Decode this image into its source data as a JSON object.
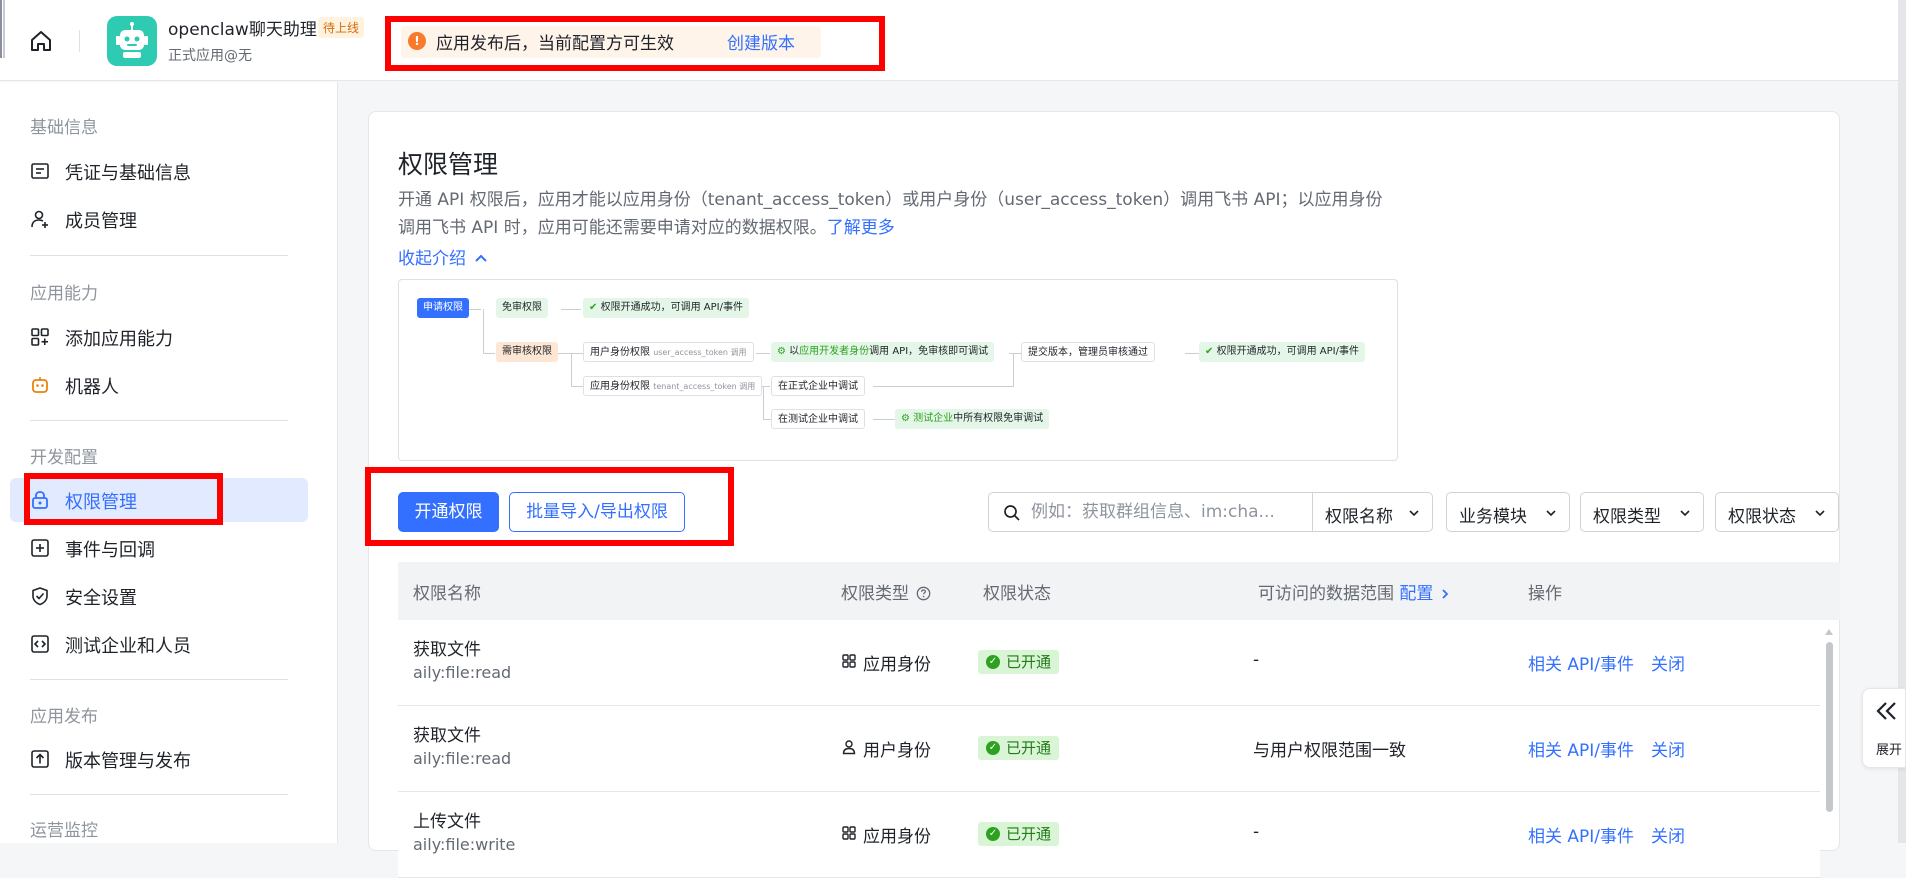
{
  "topbar": {
    "app_name": "openclaw聊天助理",
    "app_badge": "待上线",
    "app_subtitle": "正式应用@无",
    "notice_text": "应用发布后，当前配置方可生效",
    "notice_link": "创建版本"
  },
  "sidebar": {
    "sections": [
      {
        "title": "基础信息",
        "items": [
          "凭证与基础信息",
          "成员管理"
        ]
      },
      {
        "title": "应用能力",
        "items": [
          "添加应用能力",
          "机器人"
        ]
      },
      {
        "title": "开发配置",
        "items": [
          "权限管理",
          "事件与回调",
          "安全设置",
          "测试企业和人员"
        ]
      },
      {
        "title": "应用发布",
        "items": [
          "版本管理与发布"
        ]
      },
      {
        "title": "运营监控",
        "items": []
      }
    ],
    "active_item": "权限管理"
  },
  "main": {
    "title": "权限管理",
    "description": "开通 API 权限后，应用才能以应用身份（tenant_access_token）或用户身份（user_access_token）调用飞书 API；以应用身份调用飞书 API 时，应用可能还需要申请对应的数据权限。",
    "learn_more": "了解更多",
    "collapse_label": "收起介绍"
  },
  "flow": {
    "apply": "申请权限",
    "no_review": "免审权限",
    "no_review_result": "权限开通成功，可调用 API/事件",
    "needs_review": "需审核权限",
    "user_perm": "用户身份权限",
    "user_token": "user_access_token 调用",
    "dev_call_prefix": "以",
    "dev_call_highlight": "应用开发者身份",
    "dev_call_suffix": "调用 API，免审核即可调试",
    "submit": "提交版本，管理员审核通过",
    "final_result": "权限开通成功，可调用 API/事件",
    "app_perm": "应用身份权限",
    "tenant_token": "tenant_access_token 调用",
    "prod_debug": "在正式企业中调试",
    "test_debug": "在测试企业中调试",
    "test_free_highlight": "测试企业",
    "test_free_suffix": "中所有权限免审调试"
  },
  "actions": {
    "enable_button": "开通权限",
    "import_export_button": "批量导入/导出权限",
    "search_placeholder": "例如：获取群组信息、im:cha...",
    "filter_name": "权限名称",
    "filter_module": "业务模块",
    "filter_type": "权限类型",
    "filter_status": "权限状态"
  },
  "table": {
    "headers": {
      "name": "权限名称",
      "type": "权限类型",
      "status": "权限状态",
      "scope": "可访问的数据范围",
      "scope_config": "配置",
      "ops": "操作"
    },
    "rows": [
      {
        "name": "获取文件",
        "code": "aily:file:read",
        "type": "应用身份",
        "type_icon": "grid-icon",
        "status": "已开通",
        "scope": "-",
        "api": "相关 API/事件",
        "close": "关闭"
      },
      {
        "name": "获取文件",
        "code": "aily:file:read",
        "type": "用户身份",
        "type_icon": "user-icon",
        "status": "已开通",
        "scope": "与用户权限范围一致",
        "api": "相关 API/事件",
        "close": "关闭"
      },
      {
        "name": "上传文件",
        "code": "aily:file:write",
        "type": "应用身份",
        "type_icon": "grid-icon",
        "status": "已开通",
        "scope": "-",
        "api": "相关 API/事件",
        "close": "关闭"
      }
    ]
  },
  "expand_panel": {
    "label": "展开"
  },
  "colors": {
    "primary": "#3370ff",
    "highlight_frame": "#ff0000",
    "success": "#2ea121",
    "warning": "#f77b2b"
  }
}
